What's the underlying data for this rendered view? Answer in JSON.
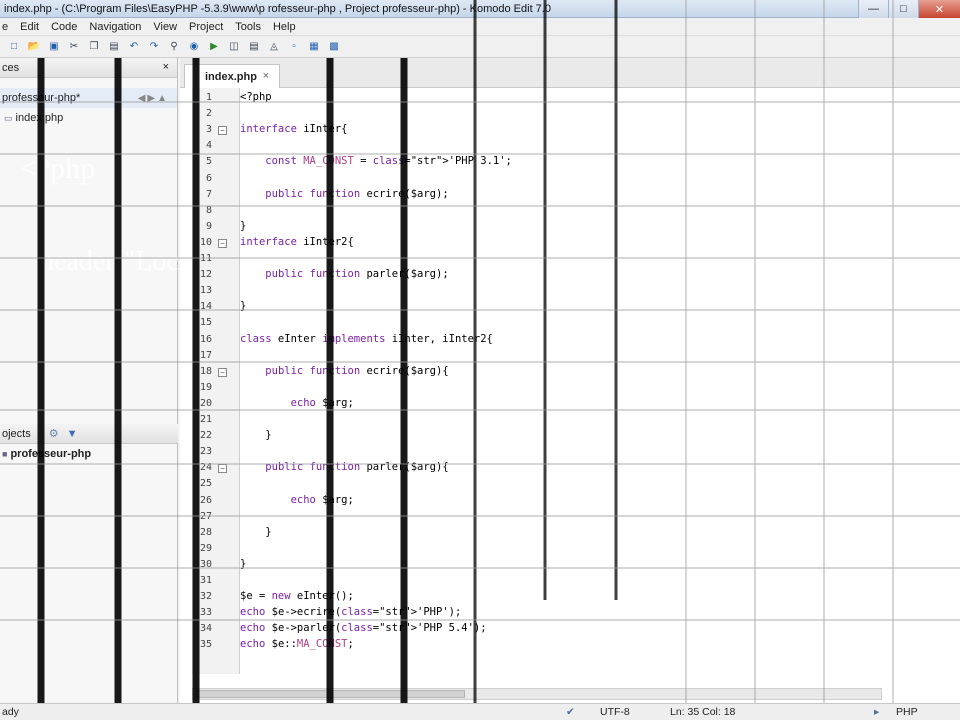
{
  "window": {
    "title": "index.php - (C:\\Program   Files\\EasyPHP   -5.3.9\\www\\p  rofesseur-php  , Project professeur-php) - Komodo Edit 7.0"
  },
  "menu": [
    "e",
    "Edit",
    "Code",
    "Navigation",
    "View",
    "Project",
    "Tools",
    "Help"
  ],
  "left_panel": {
    "places_title": "ces",
    "places_close": "×",
    "folder_label": "professeur-php*",
    "file_label": "index.php",
    "projects_title": "ojects",
    "project_label": "professeur-php"
  },
  "overlay": {
    "line1": "<?php",
    "line2": "header(\"Location: http://www.professeur-php.com\");"
  },
  "editor": {
    "tab_label": "index.php",
    "tab_close": "×",
    "lines": [
      "<?php",
      "",
      "interface iInter{",
      "",
      "    const MA_CONST = 'PHP 3.1';",
      "",
      "    public function ecrire($arg);",
      "",
      "}",
      "interface iInter2{",
      "",
      "    public function parler($arg);",
      "",
      "}",
      "",
      "class eInter implements iInter, iInter2{",
      "",
      "    public function ecrire($arg){",
      "",
      "        echo $arg;",
      "",
      "    }",
      "",
      "    public function parler($arg){",
      "",
      "        echo $arg;",
      "",
      "    }",
      "",
      "}",
      "",
      "$e = new eInter();",
      "echo $e->ecrire('PHP');",
      "echo $e->parler('PHP 5.4');",
      "echo $e::MA_CONST;"
    ],
    "line_numbers": [
      "1",
      "2",
      "3",
      "4",
      "5",
      "6",
      "7",
      "8",
      "9",
      "10",
      "11",
      "12",
      "13",
      "14",
      "15",
      "16",
      "17",
      "18",
      "19",
      "20",
      "21",
      "22",
      "23",
      "24",
      "25",
      "26",
      "27",
      "28",
      "29",
      "30",
      "31",
      "32",
      "33",
      "34",
      "35"
    ]
  },
  "status": {
    "left": "ady",
    "encoding": "UTF-8",
    "position": "Ln: 35 Col: 18",
    "language": "PHP"
  }
}
